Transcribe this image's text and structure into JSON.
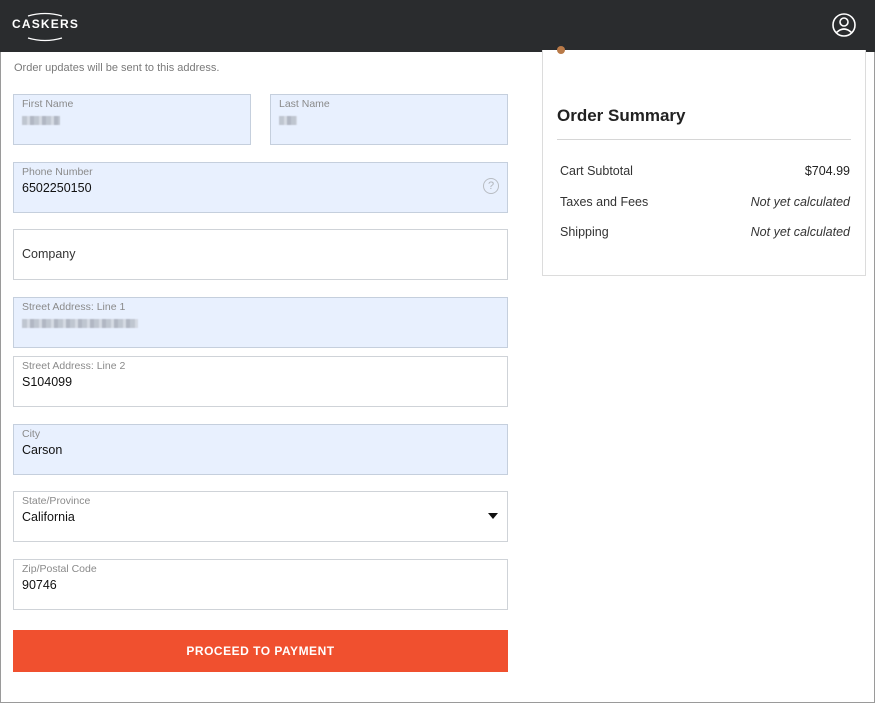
{
  "header": {
    "logo_text": "CASKERS",
    "account_icon": "user-circle-icon"
  },
  "form": {
    "notice": "Order updates will be sent to this address.",
    "first_name": {
      "label": "First Name",
      "value": ""
    },
    "last_name": {
      "label": "Last Name",
      "value": ""
    },
    "phone": {
      "label": "Phone Number",
      "value": "6502250150",
      "help_icon": "?"
    },
    "company": {
      "placeholder": "Company"
    },
    "street1": {
      "label": "Street Address: Line 1",
      "value": ""
    },
    "street2": {
      "label": "Street Address: Line 2",
      "value": "S104099"
    },
    "city": {
      "label": "City",
      "value": "Carson"
    },
    "state": {
      "label": "State/Province",
      "value": "California"
    },
    "zip": {
      "label": "Zip/Postal Code",
      "value": "90746"
    },
    "submit_label": "PROCEED TO PAYMENT"
  },
  "summary": {
    "title": "Order Summary",
    "rows": [
      {
        "label": "Cart Subtotal",
        "value": "$704.99"
      },
      {
        "label": "Taxes and Fees",
        "value": "Not yet calculated"
      },
      {
        "label": "Shipping",
        "value": "Not yet calculated"
      }
    ]
  },
  "colors": {
    "header_bg": "#2a2c2e",
    "autofill_bg": "#e8f0fe",
    "button_bg": "#f0502f"
  }
}
